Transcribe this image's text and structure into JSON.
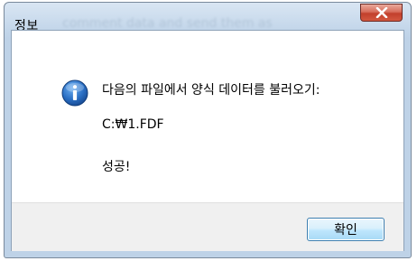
{
  "window": {
    "title": "정보",
    "background_text": "comment data and send them as",
    "close_icon": "close-icon"
  },
  "message": {
    "icon": "info-icon",
    "line1": "다음의 파일에서 양식 데이터를 불러오기:",
    "line2": "C:₩1.FDF",
    "line3": "성공!"
  },
  "buttons": {
    "ok_label": "확인"
  },
  "colors": {
    "close_button": "#c2402c",
    "ok_border": "#3c7fb1",
    "info_icon": "#1f63b5"
  }
}
